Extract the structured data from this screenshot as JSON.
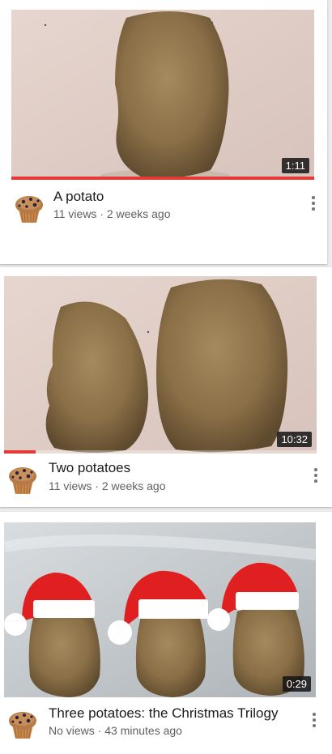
{
  "videos": [
    {
      "title": "A potato",
      "meta": "11 views · 2 weeks ago",
      "duration": "1:11",
      "watched_fraction": 1.0,
      "thumbnail_icon": "potato-thumbnail",
      "avatar_icon": "muffin-avatar"
    },
    {
      "title": "Two potatoes",
      "meta": "11 views · 2 weeks ago",
      "duration": "10:32",
      "watched_fraction": 0.1,
      "thumbnail_icon": "two-potatoes-thumbnail",
      "avatar_icon": "muffin-avatar"
    },
    {
      "title": "Three potatoes: the Christmas Trilogy",
      "meta": "No views · 43 minutes ago",
      "duration": "0:29",
      "watched_fraction": 0,
      "thumbnail_icon": "three-potatoes-santa-hats-thumbnail",
      "avatar_icon": "muffin-avatar"
    }
  ],
  "colors": {
    "progress": "#e53935",
    "background": "#ececec",
    "meta_text": "#606060"
  }
}
